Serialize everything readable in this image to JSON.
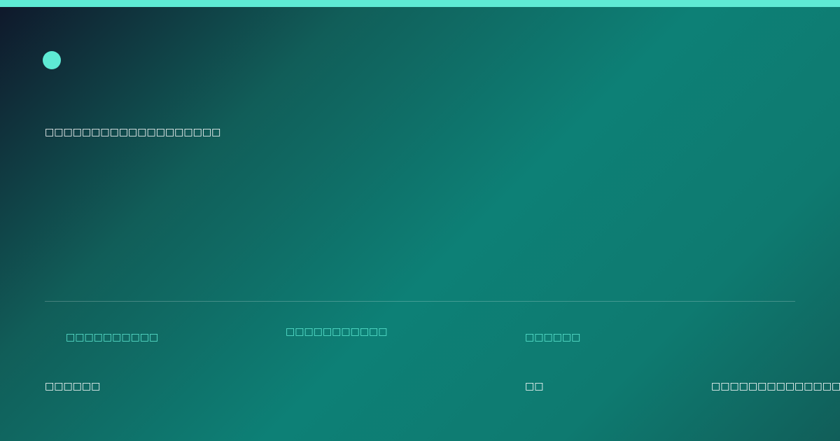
{
  "colors": {
    "accent": "#5eead4",
    "text": "#ffffff",
    "gradient_start": "#0f172a",
    "gradient_mid": "#0d8076",
    "gradient_end": "#115e59"
  },
  "headline": "□□□□□□□□□□□□□□□□□□□",
  "meta": {
    "label_1": "□□□□□□□□□□",
    "label_2": "□□□□□□□□□□□",
    "label_3": "□□□□□□",
    "value_1": "□□□□□□",
    "value_3": "□□",
    "value_4": "□□□□□□□□□□□□□□□□□□"
  }
}
